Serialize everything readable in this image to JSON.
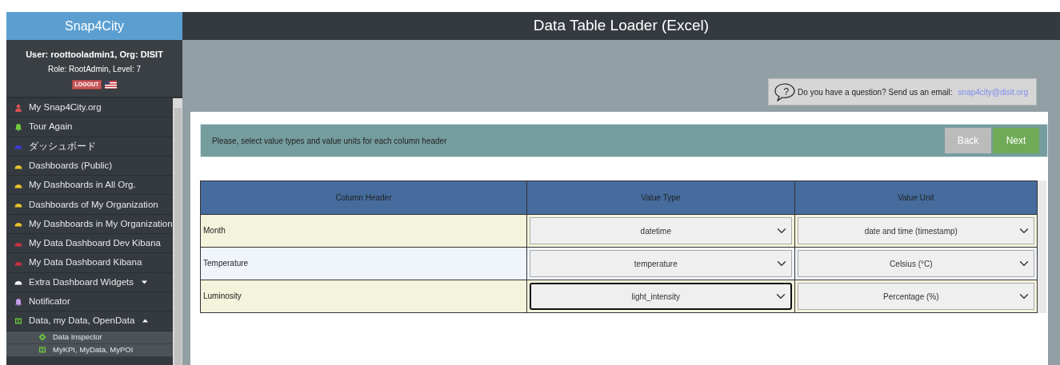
{
  "sidebar": {
    "brand": "Snap4City",
    "user": "User: roottooladmin1, Org: DISIT",
    "role": "Role: RootAdmin, Level: 7",
    "logout": "LOGOUT",
    "items": [
      {
        "label": "My Snap4City.org",
        "kind": "user",
        "color": "#d9534f"
      },
      {
        "label": "Tour Again",
        "kind": "bell",
        "color": "#6ecb3c"
      },
      {
        "label": "ダッシュボード",
        "kind": "gauge",
        "color": "#3b3bd6"
      },
      {
        "label": "Dashboards (Public)",
        "kind": "gauge",
        "color": "#e8c32c"
      },
      {
        "label": "My Dashboards in All Org.",
        "kind": "gauge",
        "color": "#e8c32c"
      },
      {
        "label": "Dashboards of My Organization",
        "kind": "gauge",
        "color": "#e8c32c"
      },
      {
        "label": "My Dashboards in My Organization",
        "kind": "gauge",
        "color": "#e8c32c"
      },
      {
        "label": "My Data Dashboard Dev Kibana",
        "kind": "gauge",
        "color": "#c9303e"
      },
      {
        "label": "My Data Dashboard Kibana",
        "kind": "gauge",
        "color": "#c9303e"
      },
      {
        "label": "Extra Dashboard Widgets",
        "kind": "gauge",
        "color": "#ffffff",
        "expanded": false
      },
      {
        "label": "Notificator",
        "kind": "bell",
        "color": "#c49be8"
      },
      {
        "label": "Data, my Data, OpenData",
        "kind": "table",
        "color": "#6ecb3c",
        "expanded": true,
        "children": [
          {
            "label": "Data Inspector",
            "kind": "crosshair",
            "color": "#6ecb3c"
          },
          {
            "label": "MyKPI, MyData, MyPOI",
            "kind": "table",
            "color": "#6ecb3c"
          }
        ]
      }
    ]
  },
  "title": "Data Table Loader (Excel)",
  "help": {
    "icon_glyph": "?",
    "text": "Do you have a question? Send us an email:",
    "email": "snap4city@disit.org"
  },
  "instruction": "Please, select value types and value units for each column header",
  "buttons": [
    {
      "label": "Back",
      "kind": "secondary"
    },
    {
      "label": "Next",
      "kind": "primary"
    }
  ],
  "table": {
    "columns": [
      "Column Header",
      "Value Type",
      "Value Unit"
    ],
    "rows": [
      {
        "header": "Month",
        "value_type": "datetime",
        "value_unit": "date and time (timestamp)",
        "focused": false
      },
      {
        "header": "Temperature",
        "value_type": "temperature",
        "value_unit": "Celsius (°C)",
        "focused": false
      },
      {
        "header": "Luminosity",
        "value_type": "light_intensity",
        "value_unit": "Percentage (%)",
        "focused": true
      }
    ]
  }
}
